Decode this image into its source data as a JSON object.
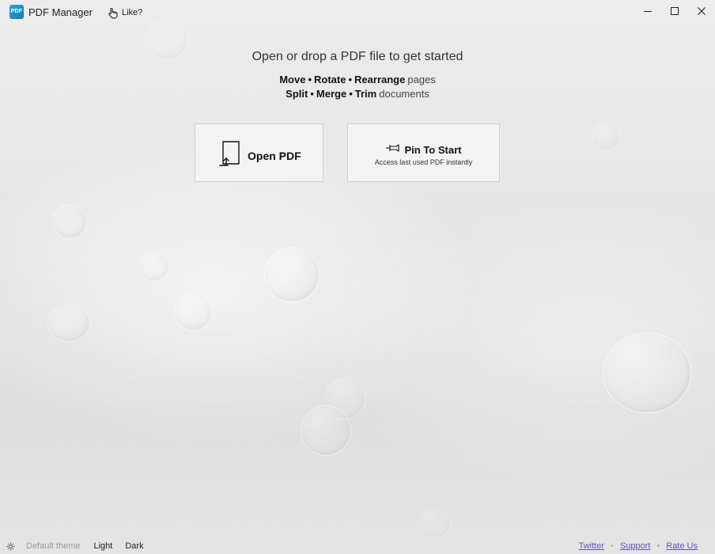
{
  "titlebar": {
    "logo_text": "PDF",
    "app_title": "PDF Manager",
    "like_label": "Like?"
  },
  "hero": {
    "headline": "Open or drop a PDF file to get started",
    "line1": {
      "items": [
        "Move",
        "Rotate",
        "Rearrange"
      ],
      "separator": "•",
      "suffix": "pages"
    },
    "line2": {
      "items": [
        "Split",
        "Merge",
        "Trim"
      ],
      "separator": "•",
      "suffix": "documents"
    }
  },
  "actions": {
    "open_pdf": {
      "label": "Open PDF",
      "icon": "open-document-icon"
    },
    "pin_to_start": {
      "label": "Pin To Start",
      "subtitle": "Access last used PDF instantly",
      "icon": "pin-icon"
    }
  },
  "footer": {
    "theme_icon": "sun-icon",
    "themes": {
      "default": "Default theme",
      "light": "Light",
      "dark": "Dark"
    },
    "links": {
      "twitter": "Twitter",
      "support": "Support",
      "rate": "Rate Us"
    },
    "link_separator": "•"
  },
  "colors": {
    "accent_link": "#6a4fb3",
    "logo": "#1e90c8",
    "muted_text": "#9a9a9a"
  }
}
